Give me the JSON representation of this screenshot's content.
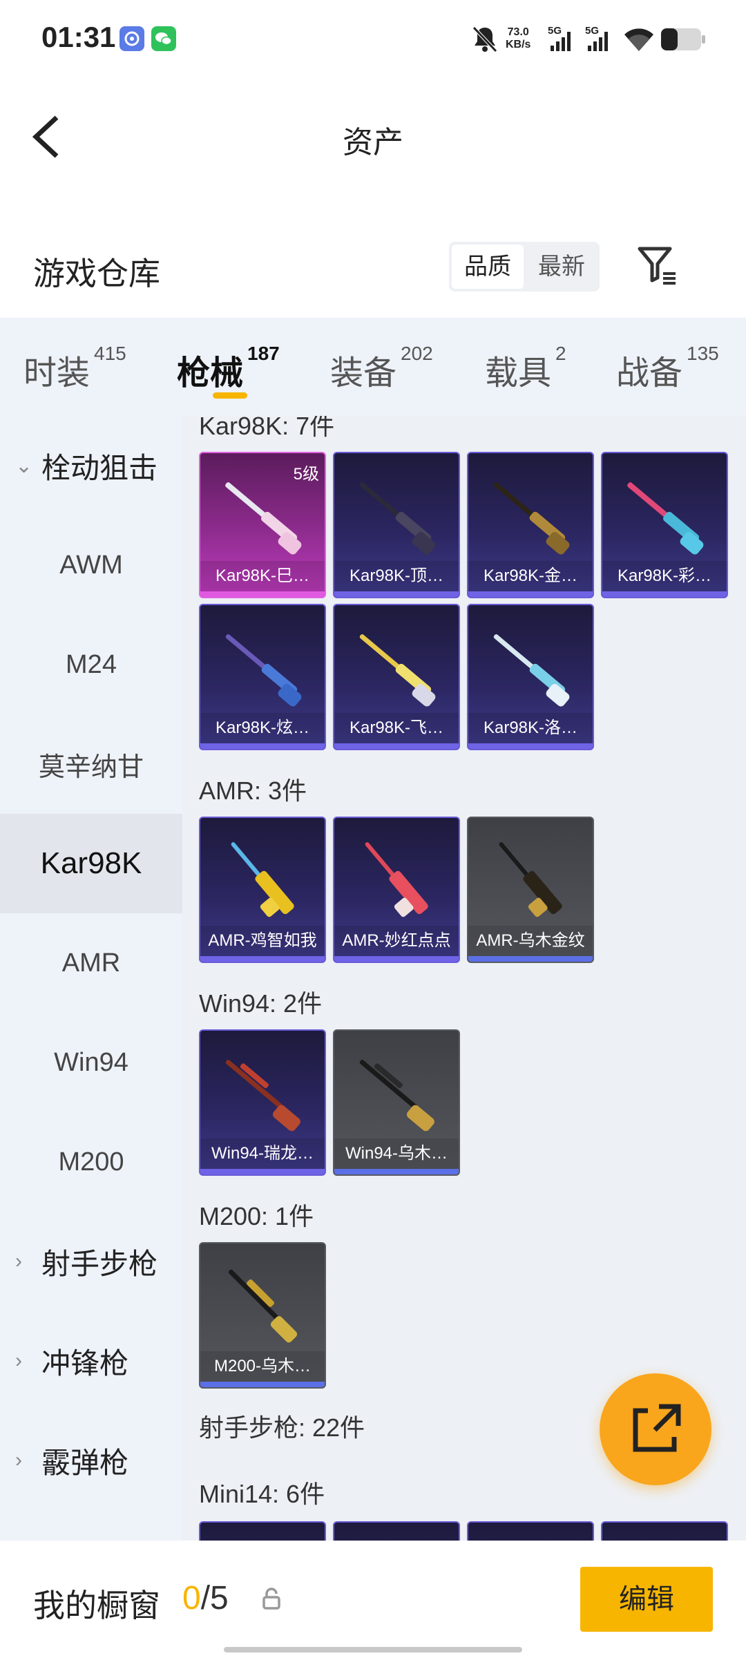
{
  "status_bar": {
    "time": "01:31",
    "net_speed_value": "73.0",
    "net_speed_unit": "KB/s",
    "signal1_label": "5G",
    "signal2_label": "5G"
  },
  "header": {
    "title": "资产"
  },
  "warehouse": {
    "title": "游戏仓库",
    "sort_quality": "品质",
    "sort_newest": "最新"
  },
  "tabs": [
    {
      "label": "时装",
      "count": "415"
    },
    {
      "label": "枪械",
      "count": "187"
    },
    {
      "label": "装备",
      "count": "202"
    },
    {
      "label": "载具",
      "count": "2"
    },
    {
      "label": "战备",
      "count": "135"
    }
  ],
  "sidebar": {
    "items": [
      {
        "label": "栓动狙击",
        "type": "group"
      },
      {
        "label": "AWM"
      },
      {
        "label": "M24"
      },
      {
        "label": "莫辛纳甘"
      },
      {
        "label": "Kar98K",
        "selected": true
      },
      {
        "label": "AMR"
      },
      {
        "label": "Win94"
      },
      {
        "label": "M200"
      },
      {
        "label": "射手步枪",
        "type": "group"
      },
      {
        "label": "冲锋枪",
        "type": "group"
      },
      {
        "label": "霰弹枪",
        "type": "group"
      }
    ]
  },
  "sections": {
    "kar98k": {
      "label": "Kar98K: 7件",
      "items": [
        {
          "name": "Kar98K-巳…",
          "level": "5级",
          "rarity": "pink"
        },
        {
          "name": "Kar98K-顶…",
          "rarity": "purple"
        },
        {
          "name": "Kar98K-金…",
          "rarity": "purple"
        },
        {
          "name": "Kar98K-彩…",
          "rarity": "purple"
        },
        {
          "name": "Kar98K-炫…",
          "rarity": "purple"
        },
        {
          "name": "Kar98K-飞…",
          "rarity": "purple"
        },
        {
          "name": "Kar98K-洛…",
          "rarity": "purple"
        }
      ]
    },
    "amr": {
      "label": "AMR: 3件",
      "items": [
        {
          "name": "AMR-鸡智如我",
          "rarity": "purple"
        },
        {
          "name": "AMR-妙红点点",
          "rarity": "purple"
        },
        {
          "name": "AMR-乌木金纹",
          "rarity": "gray"
        }
      ]
    },
    "win94": {
      "label": "Win94: 2件",
      "items": [
        {
          "name": "Win94-瑞龙…",
          "rarity": "purple"
        },
        {
          "name": "Win94-乌木…",
          "rarity": "gray"
        }
      ]
    },
    "m200": {
      "label": "M200: 1件",
      "items": [
        {
          "name": "M200-乌木…",
          "rarity": "gray"
        }
      ]
    },
    "marksman": {
      "label": "射手步枪: 22件"
    },
    "mini14": {
      "label": "Mini14: 6件"
    }
  },
  "showcase": {
    "label": "我的橱窗",
    "current": "0",
    "separator": "/5",
    "edit_label": "编辑"
  },
  "colors": {
    "accent": "#f7b500",
    "fab": "#f9a61d",
    "rarity_purple": "#6f63e6",
    "rarity_pink": "#e05ae0",
    "rarity_gray": "#585a62"
  }
}
